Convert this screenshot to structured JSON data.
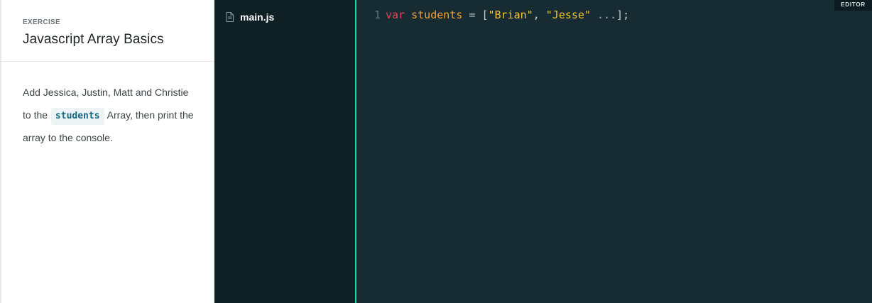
{
  "instructions": {
    "label": "EXERCISE",
    "title": "Javascript Array Basics",
    "text_before": "Add Jessica, Justin, Matt and Christie to the",
    "code_chip": "students",
    "text_after": "Array, then print the array to the console."
  },
  "filetree": {
    "files": [
      {
        "name": "main.js",
        "icon": "file-icon"
      }
    ]
  },
  "editor": {
    "badge": "EDITOR",
    "lines": [
      {
        "number": "1",
        "tokens": {
          "kw": "var",
          "var": "students",
          "op": "=",
          "open": "[",
          "str1": "\"Brian\"",
          "comma": ",",
          "str2": "\"Jesse\"",
          "ellipsis": "...",
          "close": "];"
        }
      }
    ]
  },
  "colors": {
    "editor_bg": "#162c32",
    "filetree_bg": "#0f2025",
    "accent": "#18d3a3",
    "keyword": "#e0465a",
    "variable": "#f99f35",
    "string": "#f2c433"
  }
}
